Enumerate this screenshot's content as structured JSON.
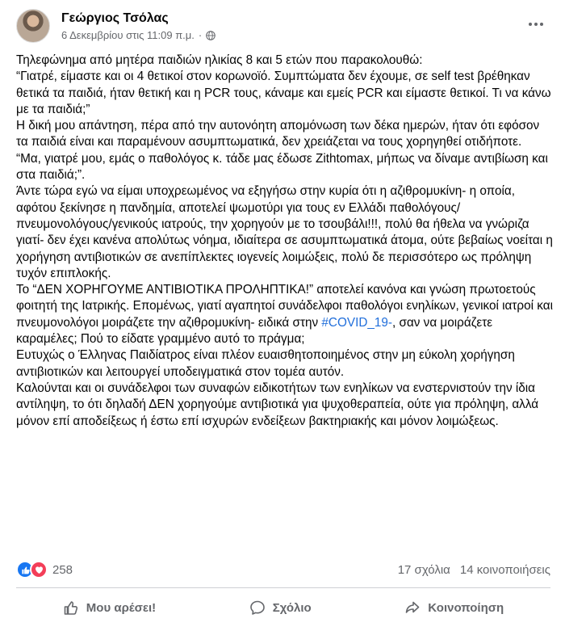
{
  "post": {
    "author": "Γεώργιος Τσόλας",
    "timestamp": "6 Δεκεμβρίου στις 11:09 π.μ.",
    "separator": "·",
    "paragraphs": [
      {
        "text": "Τηλεφώνημα από μητέρα παιδιών ηλικίας 8 και 5 ετών που παρακολουθώ:"
      },
      {
        "text": "“Γιατρέ, είμαστε και οι 4 θετικοί στον κορωνοϊό. Συμπτώματα δεν έχουμε, σε self test βρέθηκαν θετικά τα παιδιά, ήταν θετική και η PCR τους, κάναμε και εμείς PCR και είμαστε θετικοί. Τι να κάνω με τα παιδιά;”"
      },
      {
        "text": "Η δική μου απάντηση, πέρα από την αυτονόητη απομόνωση των δέκα ημερών, ήταν ότι εφόσον τα παιδιά είναι και παραμένουν ασυμπτωματικά, δεν χρειάζεται να τους χορηγηθεί οτιδήποτε."
      },
      {
        "text": "“Μα, γιατρέ μου, εμάς ο παθολόγος κ. τάδε μας έδωσε Zithtomax, μήπως να δίναμε αντιβίωση και στα παιδιά;”."
      },
      {
        "text": "Άντε τώρα εγώ να είμαι υποχρεωμένος να εξηγήσω στην κυρία ότι η αζιθρομυκίνη- η οποία, αφότου ξεκίνησε η πανδημία, αποτελεί ψωμοτύρι για τους εν Ελλάδι παθολόγους/πνευμονολόγους/γενικούς ιατρούς, την χορηγούν με το τσουβάλι!!!, πολύ θα ήθελα να γνώριζα γιατί- δεν έχει κανένα απολύτως νόημα, ιδιαίτερα σε ασυμπτωματικά άτομα, ούτε βεβαίως νοείται η χορήγηση αντιβιοτικών σε ανεπίπλεκτες ιογενείς λοιμώξεις, πολύ δε περισσότερο ως πρόληψη τυχόν επιπλοκής."
      },
      {
        "text": "Το “ΔΕΝ ΧΟΡΗΓΟΥΜΕ ΑΝΤΙΒΙΟΤΙΚΑ ΠΡΟΛΗΠΤΙΚΑ!” αποτελεί κανόνα και γνώση πρωτοετούς φοιτητή της Ιατρικής. Επομένως, γιατί αγαπητοί συνάδελφοι παθολόγοι ενηλίκων, γενικοί ιατροί και πνευμονολόγοι μοιράζετε την αζιθρομυκίνη- ειδικά στην ",
        "hashtag": "#COVID_19-",
        "after": ", σαν να μοιράζετε καραμέλες; Πού το είδατε γραμμένο αυτό το πράγμα;"
      },
      {
        "text": "Ευτυχώς ο Έλληνας Παιδίατρος είναι πλέον ευαισθητοποιημένος στην μη εύκολη χορήγηση αντιβιοτικών και λειτουργεί υποδειγματικά στον τομέα αυτόν."
      },
      {
        "text": "Καλούνται και οι συνάδελφοι των συναφών ειδικοτήτων των ενηλίκων να ενστερνιστούν την ίδια αντίληψη, το ότι δηλαδή ΔΕΝ χορηγούμε αντιβιοτικά για ψυχοθεραπεία, ούτε για πρόληψη, αλλά μόνον επί αποδείξεως ή έστω επί ισχυρών ενδείξεων βακτηριακής και μόνον λοιμώξεως."
      }
    ]
  },
  "reactions": {
    "count": "258",
    "icons": [
      "like-icon",
      "love-icon"
    ],
    "like_color": "#1877f2",
    "love_color": "#f33e58"
  },
  "stats": {
    "comments": "17 σχόλια",
    "shares": "14 κοινοποιήσεις"
  },
  "actions": {
    "like_label": "Μου αρέσει!",
    "comment_label": "Σχόλιο",
    "share_label": "Κοινοποίηση"
  },
  "colors": {
    "hashtag": "#216fdb",
    "secondary_text": "#65676b",
    "divider": "#ced0d4"
  }
}
